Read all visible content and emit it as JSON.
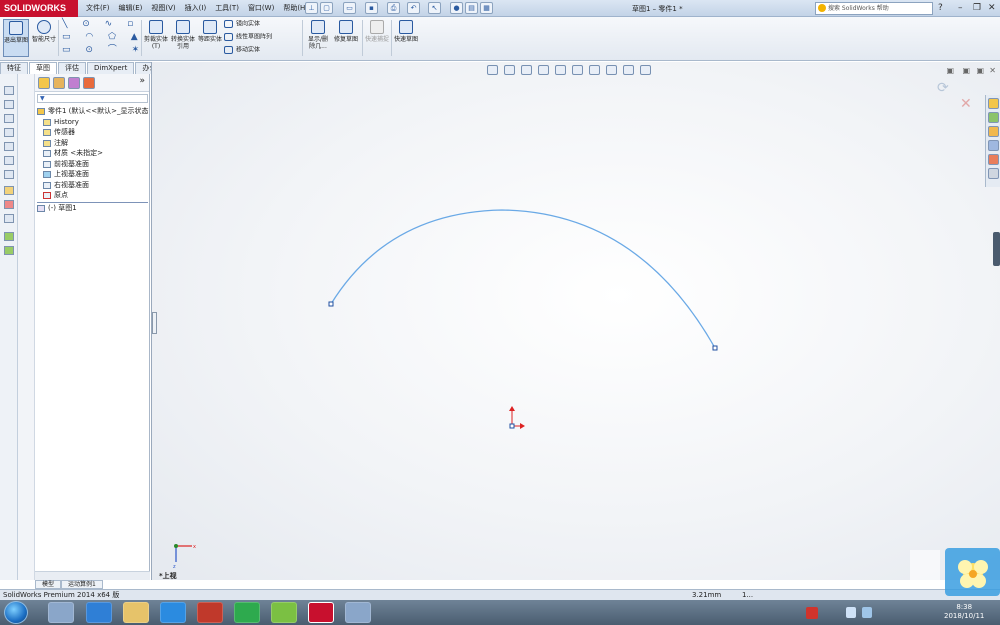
{
  "app": {
    "logo_text": "SOLIDWORKS",
    "document_title": "草图1 – 零件1 *",
    "search_placeholder": "搜索 SolidWorks 帮助"
  },
  "menu": [
    "文件(F)",
    "编辑(E)",
    "视图(V)",
    "插入(I)",
    "工具(T)",
    "窗口(W)",
    "帮助(H)"
  ],
  "toolbar": {
    "exit_sketch": "退出草图",
    "smart_dimension": "智能尺寸",
    "trim": "剪裁实体(T)",
    "convert": "转换实体引用",
    "offset": "等距实体",
    "mirror": "镜向实体",
    "linear_pattern": "线性草图阵列",
    "move": "移动实体",
    "show_delete": "显示/删除几...",
    "repair": "修复草图",
    "quick_snap": "快速捕捉",
    "quick_sketch": "快速草图"
  },
  "tabs": [
    "特征",
    "草图",
    "评估",
    "DimXpert",
    "办公室产品"
  ],
  "tree": {
    "root": "零件1 (默认<<默认>_显示状态",
    "items": [
      "History",
      "传感器",
      "注解",
      "材质 <未指定>",
      "前视基准面",
      "上视基准面",
      "右视基准面",
      "原点",
      "(-) 草图1"
    ]
  },
  "bottom_tabs": [
    "模型",
    "运动算例1"
  ],
  "view_label": "*上视",
  "status": {
    "product": "SolidWorks Premium 2014 x64 版",
    "measure1": "3.21mm",
    "measure2": "1..."
  },
  "clock": {
    "time": "8:38",
    "date": "2018/10/11"
  },
  "colors": {
    "arc": "#6aa9e6",
    "accent": "#c8102e",
    "taskbar": "#4a5d70"
  }
}
